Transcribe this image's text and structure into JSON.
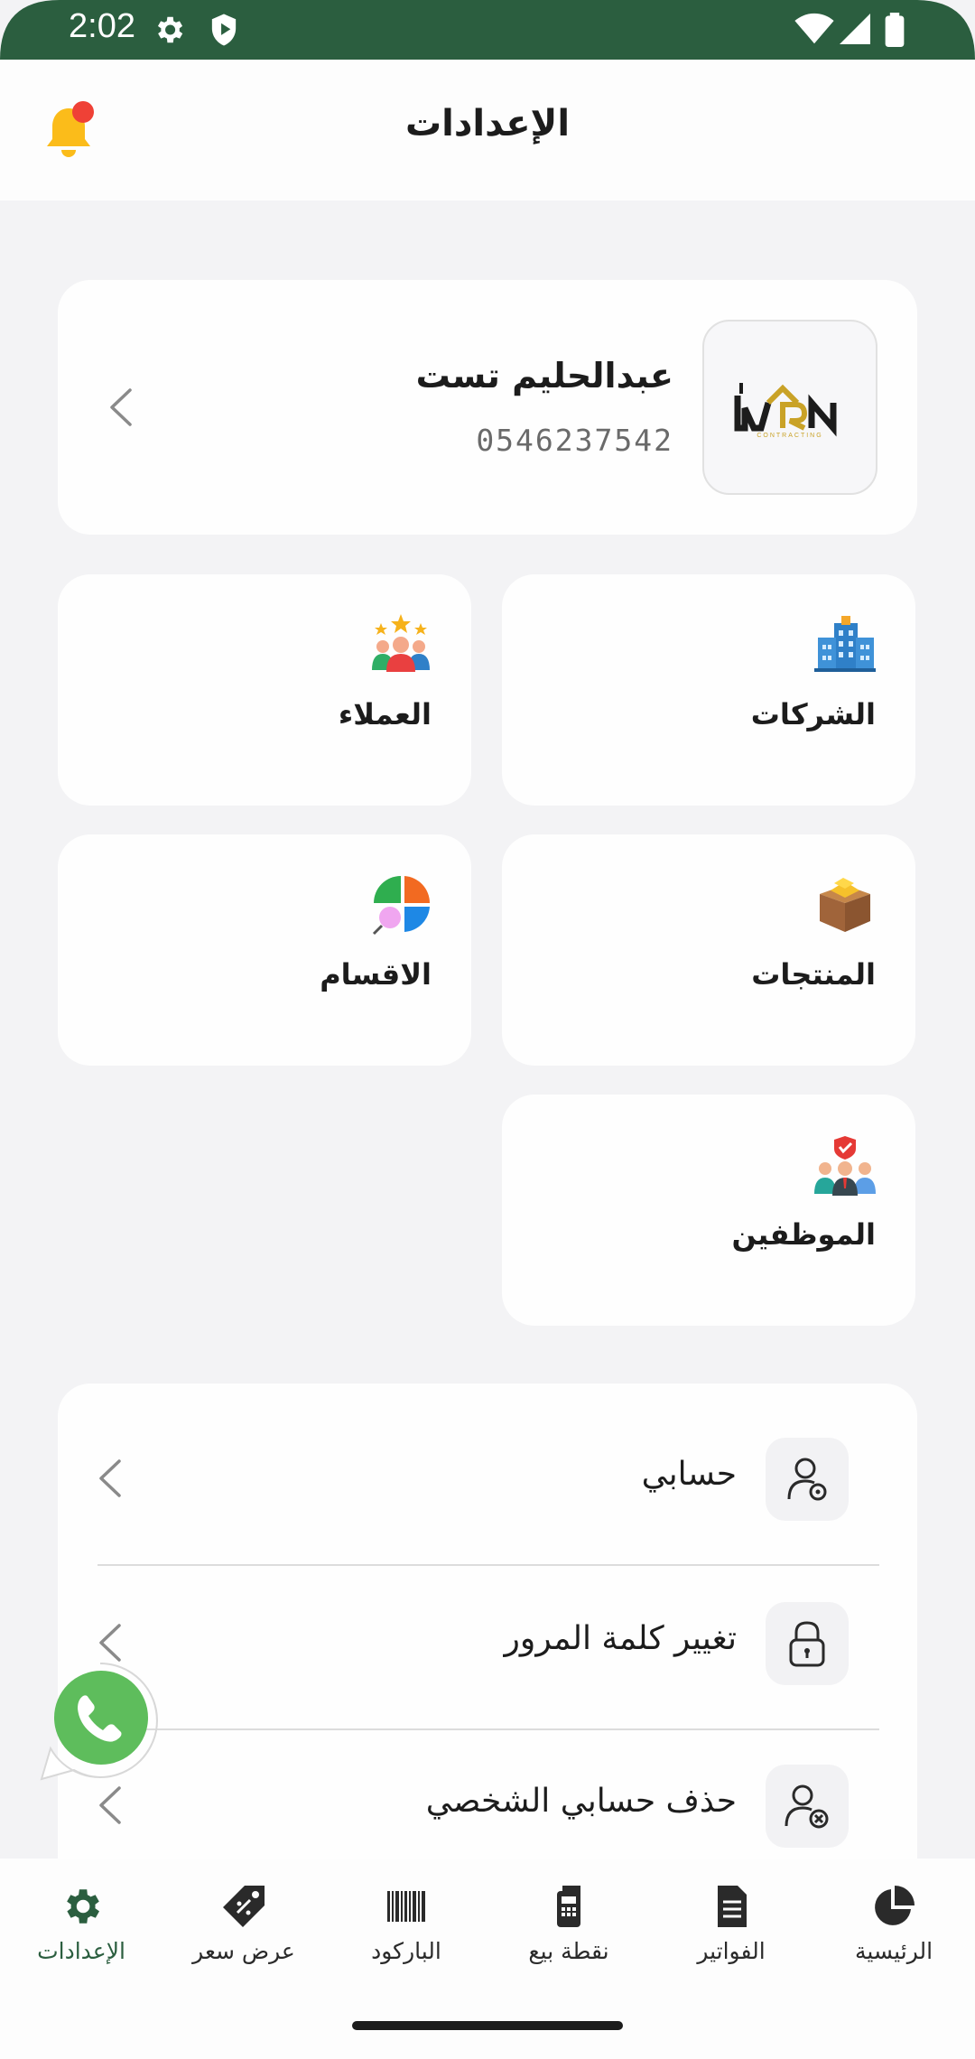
{
  "status_bar": {
    "time": "2:02"
  },
  "header": {
    "title": "الإعدادات"
  },
  "profile": {
    "name": "عبدالحليم تست",
    "phone": "0546237542",
    "logo_text": "WRN",
    "logo_subtext": "CONTRACTING"
  },
  "tiles": {
    "companies": "الشركات",
    "customers": "العملاء",
    "products": "المنتجات",
    "categories": "الاقسام",
    "employees": "الموظفين"
  },
  "menu": {
    "my_account": "حسابي",
    "change_password": "تغيير كلمة المرور",
    "delete_account": "حذف حسابي الشخصي"
  },
  "bottom_nav": {
    "home": "الرئيسية",
    "invoices": "الفواتير",
    "pos": "نقطة بيع",
    "barcode": "الباركود",
    "quote": "عرض سعر",
    "settings": "الإعدادات"
  },
  "colors": {
    "brand_green": "#2b5e3f",
    "bell": "#fbbc1a",
    "badge": "#ef4136",
    "whatsapp": "#5ebd5c"
  },
  "icons": {
    "status": [
      "settings-icon",
      "shield-play-icon",
      "wifi-icon",
      "signal-icon",
      "battery-icon"
    ],
    "header": "bell-icon",
    "whatsapp": "whatsapp-icon"
  }
}
